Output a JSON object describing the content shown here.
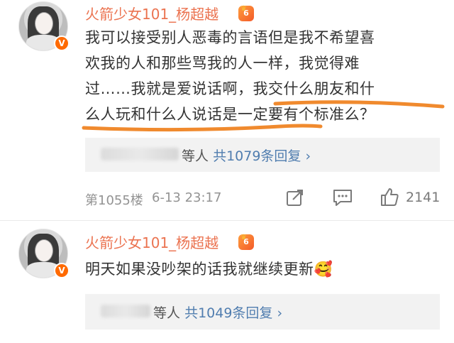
{
  "comments": [
    {
      "username": "火箭少女101_杨超越",
      "level_badge": "6",
      "verified": "V",
      "lines": [
        "我可以接受别人恶毒的言语但是我不希望喜",
        "欢我的人和那些骂我的人一样，我觉得难",
        "过……我就是爱说话啊，我交什么朋友和什",
        "么人玩和什么人说话是一定要有个标准么？"
      ],
      "reply_suffix": "等人",
      "reply_link": "共1079条回复 ›",
      "floor": "第1055楼",
      "time": "6-13 23:17",
      "likes": "2141"
    },
    {
      "username": "火箭少女101_杨超越",
      "level_badge": "6",
      "verified": "V",
      "lines": [
        "明天如果没吵架的话我就继续更新🥰"
      ],
      "reply_suffix": "等人",
      "reply_link": "共1049条回复 ›"
    }
  ],
  "colors": {
    "username": "#eb7350",
    "link": "#507daf",
    "highlight": "#f08a2e"
  },
  "icons": [
    "share-icon",
    "comment-icon",
    "thumbs-up-icon",
    "verified-icon",
    "level-icon"
  ]
}
